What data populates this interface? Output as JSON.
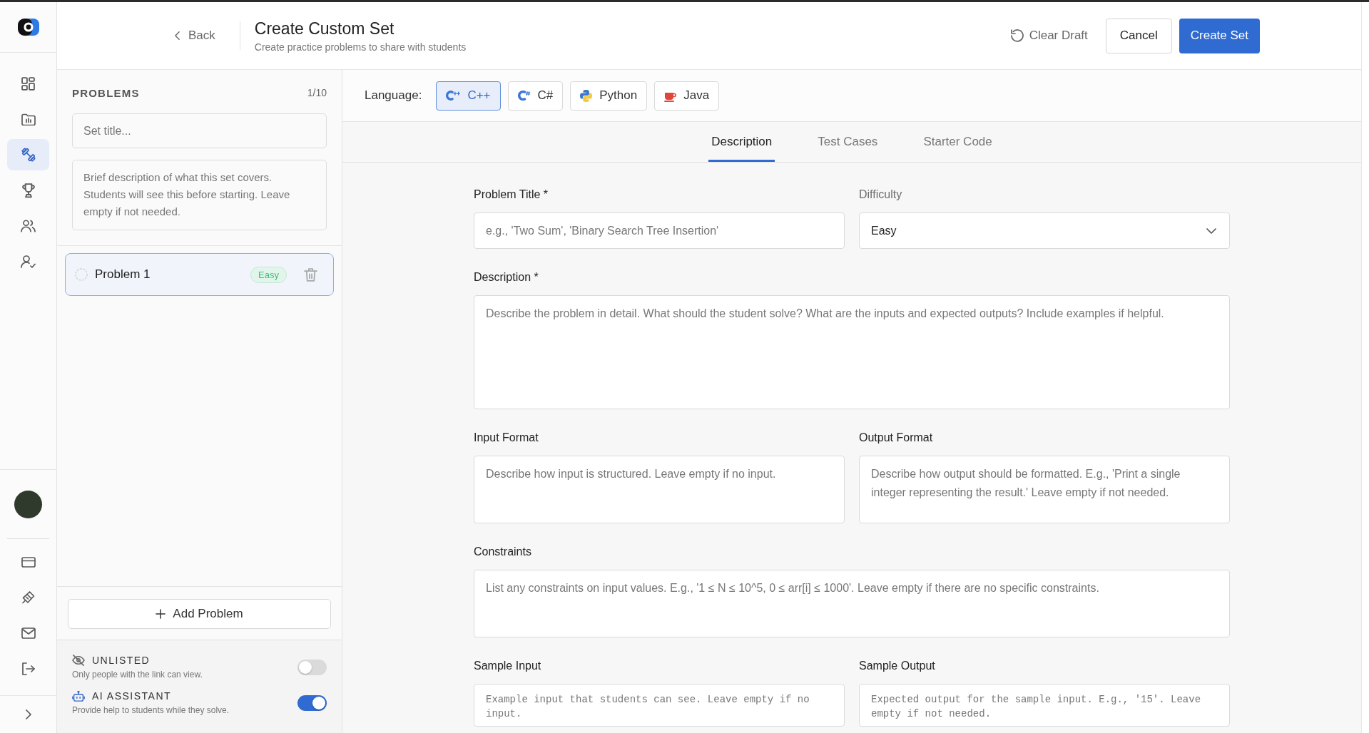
{
  "nav_rail": {
    "items": [
      {
        "selected": false
      },
      {
        "selected": false
      },
      {
        "selected": true
      },
      {
        "selected": false
      },
      {
        "selected": false
      },
      {
        "selected": false
      }
    ]
  },
  "header": {
    "back": "Back",
    "title": "Create Custom Set",
    "subtitle": "Create practice problems to share with students",
    "actions": [
      {
        "label": "Clear Draft",
        "kind": "text"
      },
      {
        "label": "Cancel",
        "kind": "secondary"
      },
      {
        "label": "Create Set",
        "kind": "primary"
      }
    ]
  },
  "problems_panel": {
    "heading": "PROBLEMS",
    "count": "1/10",
    "title_field": {
      "placeholder": "Set title..."
    },
    "description_field": {
      "placeholder": "Brief description of what this set covers. Students will see this before starting. Leave empty if not needed."
    },
    "problems": [
      {
        "title": "Problem 1",
        "difficulty": "Easy",
        "complete": false,
        "selected": true
      }
    ],
    "add_button": "Add Problem",
    "settings": [
      {
        "label": "UNLISTED",
        "description": "Only people with the link can view.",
        "on": false
      },
      {
        "label": "AI ASSISTANT",
        "description": "Provide help to students while they solve.",
        "on": true
      }
    ]
  },
  "language": {
    "label": "Language:",
    "options": [
      {
        "label": "C++",
        "selected": true
      },
      {
        "label": "C#",
        "selected": false
      },
      {
        "label": "Python",
        "selected": false
      },
      {
        "label": "Java",
        "selected": false
      }
    ]
  },
  "tabs": [
    {
      "label": "Description",
      "selected": true
    },
    {
      "label": "Test Cases",
      "selected": false
    },
    {
      "label": "Starter Code",
      "selected": false
    }
  ],
  "form": {
    "rows": [
      [
        {
          "label": "Problem Title *",
          "kind": "input",
          "placeholder": "e.g., 'Two Sum', 'Binary Search Tree Insertion'"
        },
        {
          "label": "Difficulty",
          "kind": "select",
          "value": "Easy"
        }
      ],
      [
        {
          "label": "Description *",
          "kind": "textarea_tall",
          "placeholder": "Describe the problem in detail. What should the student solve? What are the inputs and expected outputs? Include examples if helpful."
        }
      ],
      [
        {
          "label": "Input Format",
          "kind": "textarea",
          "placeholder": "Describe how input is structured. Leave empty if no input."
        },
        {
          "label": "Output Format",
          "kind": "textarea",
          "placeholder": "Describe how output should be formatted. E.g., 'Print a single integer representing the result.' Leave empty if not needed."
        }
      ],
      [
        {
          "label": "Constraints",
          "kind": "textarea",
          "placeholder": "List any constraints on input values. E.g., '1 ≤ N ≤ 10^5, 0 ≤ arr[i] ≤ 1000'. Leave empty if there are no specific constraints."
        }
      ],
      [
        {
          "label": "Sample Input",
          "kind": "code",
          "placeholder": "Example input that students can see. Leave empty if no input."
        },
        {
          "label": "Sample Output",
          "kind": "code",
          "placeholder": "Expected output for the sample input. E.g., '15'. Leave empty if not needed."
        }
      ]
    ]
  }
}
